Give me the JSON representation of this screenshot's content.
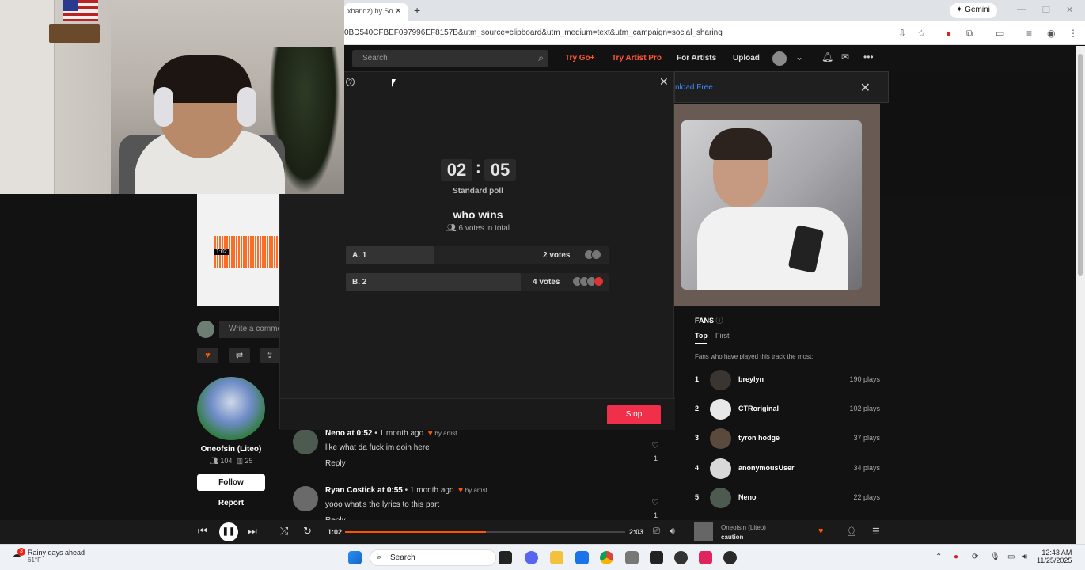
{
  "browser": {
    "tab_title": "xbandz) by So",
    "tab_close": "✕",
    "new_tab": "+",
    "gemini_label": "Gemini",
    "url": "0BD540CFBEF097996EF8157B&utm_source=clipboard&utm_medium=text&utm_campaign=social_sharing",
    "win_min": "—",
    "win_max": "❐",
    "win_close": "✕"
  },
  "header": {
    "search_placeholder": "Search",
    "try_go": "Try Go+",
    "try_artist_pro": "Try Artist Pro",
    "for_artists": "For Artists",
    "upload": "Upload",
    "colors": {
      "accent": "#ff5500",
      "try_link": "#ff5533"
    }
  },
  "banner": {
    "text": "nload Free",
    "close": "✕"
  },
  "poll": {
    "minutes": "02",
    "seconds": "05",
    "separator": ":",
    "type": "Standard poll",
    "question": "who wins",
    "total": "6 votes in total",
    "options": [
      {
        "label": "A. 1",
        "votes": "2 votes",
        "fraction": 0.333
      },
      {
        "label": "B. 2",
        "votes": "4 votes",
        "fraction": 0.667
      }
    ],
    "stop_label": "Stop",
    "close": "✕",
    "help": "?"
  },
  "left": {
    "wave_time": "1:02",
    "comment_placeholder": "Write a comme",
    "artist_name": "Oneofsin (Liteo)",
    "followers": "104",
    "tracks": "25",
    "follow_label": "Follow",
    "report_label": "Report"
  },
  "comments": [
    {
      "user": "Neno",
      "at": "at",
      "time": "0:52",
      "ago": "• 1 month ago",
      "by_artist": "by artist",
      "text": "like what da fuck im doin here",
      "reply": "Reply",
      "likes": "1"
    },
    {
      "user": "Ryan Costick",
      "at": "at",
      "time": "0:55",
      "ago": "• 1 month ago",
      "by_artist": "by artist",
      "text": "yooo what's the lyrics to this part",
      "reply": "Reply",
      "likes": "1"
    }
  ],
  "fans": {
    "title": "FANS",
    "tab_top": "Top",
    "tab_first": "First",
    "description": "Fans who have played this track the most:",
    "rows": [
      {
        "rank": "1",
        "name": "breylyn",
        "plays": "190 plays"
      },
      {
        "rank": "2",
        "name": "CTRoriginal",
        "plays": "102 plays"
      },
      {
        "rank": "3",
        "name": "tyron hodge",
        "plays": "37 plays"
      },
      {
        "rank": "4",
        "name": "anonymousUser",
        "plays": "34 plays"
      },
      {
        "rank": "5",
        "name": "Neno",
        "plays": "22 plays"
      }
    ]
  },
  "player": {
    "current": "1:02",
    "duration": "2:03",
    "progress": 0.504,
    "artist": "Oneofsin (Liteo)",
    "title": "caution"
  },
  "taskbar": {
    "weather_title": "Rainy days ahead",
    "weather_temp": "61°F",
    "weather_badge": "3",
    "search": "Search",
    "time": "12:43 AM",
    "date": "11/25/2025"
  }
}
